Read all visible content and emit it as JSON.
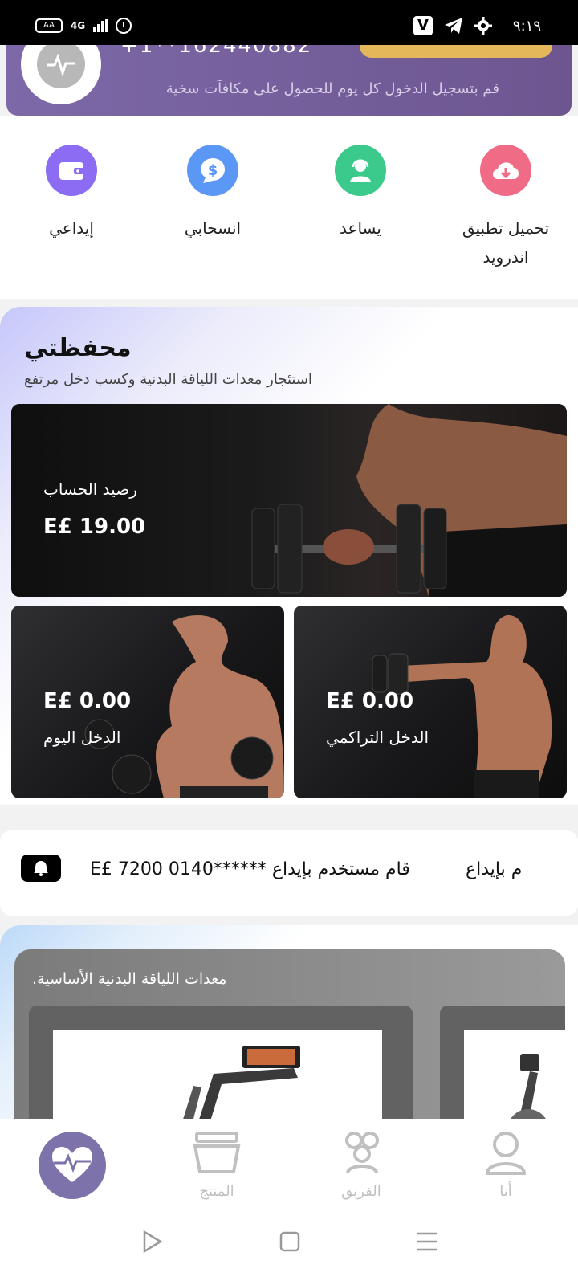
{
  "status_bar": {
    "battery": "AA",
    "network": "4G",
    "time": "٩:١٩"
  },
  "header": {
    "phone_partial": "+1**162440882",
    "message": "قم بتسجيل الدخول كل يوم للحصول على مكافآت سخية"
  },
  "actions": [
    {
      "label": "تحميل تطبيق اندرويد",
      "color": "#f06b86",
      "icon": "cloud-download-icon"
    },
    {
      "label": "يساعد",
      "color": "#3cc98c",
      "icon": "support-agent-icon"
    },
    {
      "label": "انسحابي",
      "color": "#5b97f5",
      "icon": "dollar-bubble-icon"
    },
    {
      "label": "إيداعي",
      "color": "#8b6cf2",
      "icon": "wallet-icon"
    }
  ],
  "wallet": {
    "title": "محفظتي",
    "subtitle": "استئجار معدات اللياقة البدنية وكسب دخل مرتفع",
    "balance_label": "رصيد الحساب",
    "balance_value": "E£ 19.00",
    "today_income_value": "E£ 0.00",
    "today_income_label": "الدخل اليوم",
    "cumulative_income_value": "E£ 0.00",
    "cumulative_income_label": "الدخل التراكمي"
  },
  "notice": {
    "text": "E£ 7200 0140****** قام مستخدم بإيداع",
    "tail": "م بإيداع"
  },
  "products": {
    "title": "معدات اللياقة البدنية الأساسية."
  },
  "bottom_nav": [
    {
      "label": "أنا",
      "icon": "user-icon"
    },
    {
      "label": "الفريق",
      "icon": "team-icon"
    },
    {
      "label": "المنتج",
      "icon": "product-box-icon"
    },
    {
      "label": "",
      "icon": "heartbeat-icon"
    }
  ],
  "colors": {
    "header_purple": "#7d69a8",
    "home_button": "#7d72a9",
    "accent_gold": "#e3b75a"
  }
}
